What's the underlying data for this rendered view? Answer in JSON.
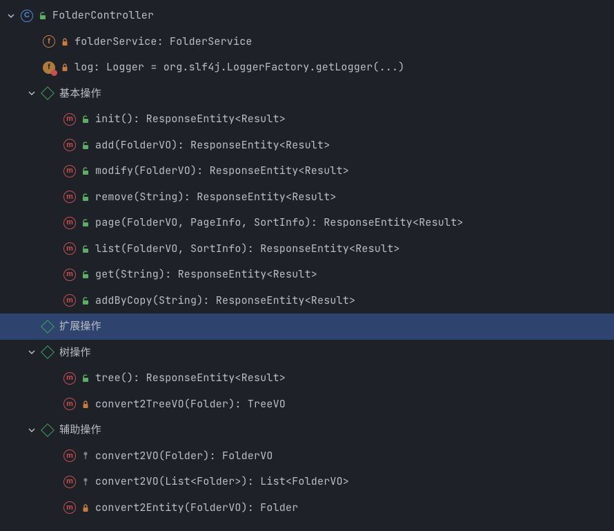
{
  "root": {
    "name": "FolderController",
    "fields": [
      {
        "sig": "folderService: FolderService",
        "vis": "private",
        "style": "outline"
      },
      {
        "sig": "log: Logger = org.slf4j.LoggerFactory.getLogger(...)",
        "vis": "private",
        "style": "filled",
        "badge": true
      }
    ],
    "groups": [
      {
        "label": "基本操作",
        "expanded": true,
        "methods": [
          {
            "sig": "init(): ResponseEntity<Result>",
            "vis": "public"
          },
          {
            "sig": "add(FolderVO): ResponseEntity<Result>",
            "vis": "public"
          },
          {
            "sig": "modify(FolderVO): ResponseEntity<Result>",
            "vis": "public"
          },
          {
            "sig": "remove(String): ResponseEntity<Result>",
            "vis": "public"
          },
          {
            "sig": "page(FolderVO, PageInfo, SortInfo): ResponseEntity<Result>",
            "vis": "public"
          },
          {
            "sig": "list(FolderVO, SortInfo): ResponseEntity<Result>",
            "vis": "public"
          },
          {
            "sig": "get(String): ResponseEntity<Result>",
            "vis": "public"
          },
          {
            "sig": "addByCopy(String): ResponseEntity<Result>",
            "vis": "public"
          }
        ]
      },
      {
        "label": "扩展操作",
        "expanded": false,
        "selected": true,
        "methods": []
      },
      {
        "label": "树操作",
        "expanded": true,
        "methods": [
          {
            "sig": "tree(): ResponseEntity<Result>",
            "vis": "public"
          },
          {
            "sig": "convert2TreeVO(Folder): TreeVO",
            "vis": "private"
          }
        ]
      },
      {
        "label": "辅助操作",
        "expanded": true,
        "methods": [
          {
            "sig": "convert2VO(Folder): FolderVO",
            "vis": "package"
          },
          {
            "sig": "convert2VO(List<Folder>): List<FolderVO>",
            "vis": "package"
          },
          {
            "sig": "convert2Entity(FolderVO): Folder",
            "vis": "private"
          }
        ]
      }
    ]
  }
}
